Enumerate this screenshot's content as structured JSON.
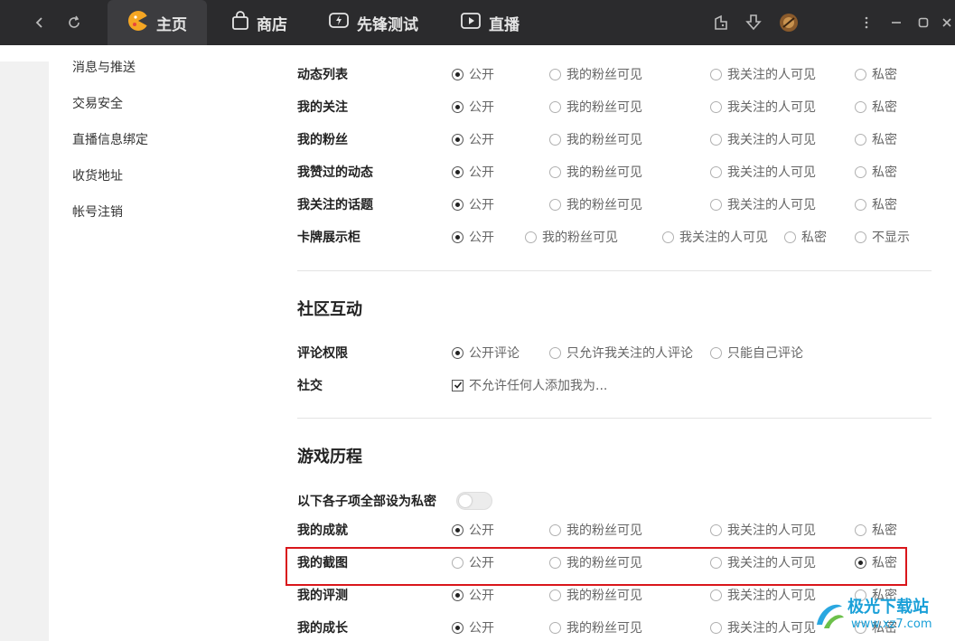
{
  "topbar": {
    "tabs": [
      {
        "label": "主页",
        "icon": "pacman-logo-icon",
        "active": true
      },
      {
        "label": "商店",
        "icon": "shopping-bag-icon",
        "active": false
      },
      {
        "label": "先锋测试",
        "icon": "flash-chat-icon",
        "active": false
      },
      {
        "label": "直播",
        "icon": "play-icon",
        "active": false
      }
    ]
  },
  "sidebar": {
    "items": [
      "消息与推送",
      "交易安全",
      "直播信息绑定",
      "收货地址",
      "帐号注销"
    ]
  },
  "visibility_rows": [
    {
      "label": "动态列表",
      "options": [
        "公开",
        "我的粉丝可见",
        "我关注的人可见",
        "私密"
      ],
      "selected": 0
    },
    {
      "label": "我的关注",
      "options": [
        "公开",
        "我的粉丝可见",
        "我关注的人可见",
        "私密"
      ],
      "selected": 0
    },
    {
      "label": "我的粉丝",
      "options": [
        "公开",
        "我的粉丝可见",
        "我关注的人可见",
        "私密"
      ],
      "selected": 0
    },
    {
      "label": "我赞过的动态",
      "options": [
        "公开",
        "我的粉丝可见",
        "我关注的人可见",
        "私密"
      ],
      "selected": 0
    },
    {
      "label": "我关注的话题",
      "options": [
        "公开",
        "我的粉丝可见",
        "我关注的人可见",
        "私密"
      ],
      "selected": 0
    },
    {
      "label": "卡牌展示柜",
      "options": [
        "公开",
        "我的粉丝可见",
        "我关注的人可见",
        "私密",
        "不显示"
      ],
      "selected": 0
    }
  ],
  "community": {
    "title": "社区互动",
    "comment_label": "评论权限",
    "comment_options": [
      "公开评论",
      "只允许我关注的人评论",
      "只能自己评论"
    ],
    "comment_selected": 0,
    "social_label": "社交",
    "social_checkbox": "不允许任何人添加我为...",
    "social_checked": true
  },
  "game_history": {
    "title": "游戏历程",
    "toggle_label": "以下各子项全部设为私密",
    "toggle_on": false,
    "rows": [
      {
        "label": "我的成就",
        "options": [
          "公开",
          "我的粉丝可见",
          "我关注的人可见",
          "私密"
        ],
        "selected": 0
      },
      {
        "label": "我的截图",
        "options": [
          "公开",
          "我的粉丝可见",
          "我关注的人可见",
          "私密"
        ],
        "selected": 3
      },
      {
        "label": "我的评测",
        "options": [
          "公开",
          "我的粉丝可见",
          "我关注的人可见",
          "私密"
        ],
        "selected": 0
      },
      {
        "label": "我的成长",
        "options": [
          "公开",
          "我的粉丝可见",
          "我关注的人可见",
          "私密"
        ],
        "selected": 0
      }
    ]
  },
  "watermark": {
    "title": "极光下载站",
    "url": "www.xz7.com"
  },
  "colors": {
    "topbar": "#2b2b2d",
    "highlight": "#d9161b",
    "accent_logo": "#f5a623"
  }
}
